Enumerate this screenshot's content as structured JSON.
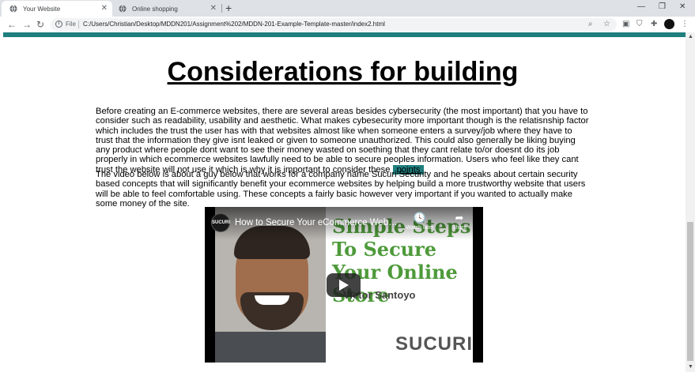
{
  "browser": {
    "tabs": [
      {
        "title": "Your Website",
        "active": true
      },
      {
        "title": "Online shopping",
        "active": false
      }
    ],
    "new_tab_symbol": "+",
    "window_controls": [
      "minimize",
      "restore",
      "close"
    ],
    "address": {
      "scheme_label": "File",
      "url": "C:/Users/Christian/Desktop/MDDN201/Assignment%202/MDDN-201-Example-Template-master/index2.html"
    }
  },
  "page": {
    "accent_color": "#1f7e7e",
    "heading": "Considerations for building",
    "paragraph1": "Before creating an E-commerce websites, there are several areas besides cybersecurity (the most important) that you have to consider such as readability, usability and aesthetic. What makes cybesecurity more important though is the relatisnship factor which includes the trust the user has with that websites almost like when someone enters a survey/job where they have to trust that the information they give isnt leaked or given to someone unauthorized. This could also generally be liking buying any product where people dont want to see their money wasted on soething that they cant relate to/or doesnt do its job properly in which ecommerce websites lawfully need to be able to secure peoples information. Users who feel like they cant trust the website will not use it which is why it is important to consider these",
    "points_link": "points",
    "paragraph2": "The video below is about a guy below that works for a company name Sucuri Security and he speaks about certain security based concepts that will significantly benefit your ecommerce websites by helping build a more trustworthy website that users will be able to feel comfortable using. These concepts a fairly basic however very important if you wanted to actually make some money of the site.",
    "video": {
      "title": "How to Secure Your eCommerce Website",
      "channel_badge": "SUCURI",
      "watch_later": "Watch later",
      "share": "Share",
      "thumbnail_text": "Simple Steps To Secure Your Online Store",
      "presenter": "Victor Santoyo",
      "logo": "SUCURI"
    }
  }
}
